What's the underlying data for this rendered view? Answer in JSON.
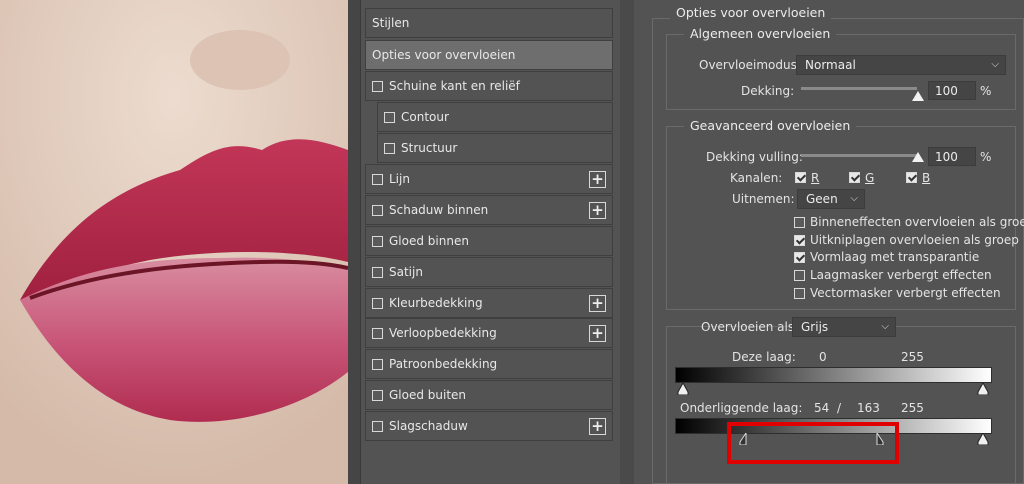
{
  "styles_panel": {
    "items": [
      {
        "label": "Stijlen",
        "checkbox": false,
        "plus": false,
        "selected": false,
        "sub": false
      },
      {
        "label": "Opties voor overvloeien",
        "checkbox": false,
        "plus": false,
        "selected": true,
        "sub": false
      },
      {
        "label": "Schuine kant en reliëf",
        "checkbox": true,
        "plus": false,
        "selected": false,
        "sub": false
      },
      {
        "label": "Contour",
        "checkbox": true,
        "plus": false,
        "selected": false,
        "sub": true
      },
      {
        "label": "Structuur",
        "checkbox": true,
        "plus": false,
        "selected": false,
        "sub": true
      },
      {
        "label": "Lijn",
        "checkbox": true,
        "plus": true,
        "selected": false,
        "sub": false
      },
      {
        "label": "Schaduw binnen",
        "checkbox": true,
        "plus": true,
        "selected": false,
        "sub": false
      },
      {
        "label": "Gloed binnen",
        "checkbox": true,
        "plus": false,
        "selected": false,
        "sub": false
      },
      {
        "label": "Satijn",
        "checkbox": true,
        "plus": false,
        "selected": false,
        "sub": false
      },
      {
        "label": "Kleurbedekking",
        "checkbox": true,
        "plus": true,
        "selected": false,
        "sub": false
      },
      {
        "label": "Verloopbedekking",
        "checkbox": true,
        "plus": true,
        "selected": false,
        "sub": false
      },
      {
        "label": "Patroonbedekking",
        "checkbox": true,
        "plus": false,
        "selected": false,
        "sub": false
      },
      {
        "label": "Gloed buiten",
        "checkbox": true,
        "plus": false,
        "selected": false,
        "sub": false
      },
      {
        "label": "Slagschaduw",
        "checkbox": true,
        "plus": true,
        "selected": false,
        "sub": false
      }
    ],
    "plus_symbol": "+"
  },
  "options": {
    "title": "Opties voor overvloeien",
    "general": {
      "title": "Algemeen overvloeien",
      "blend_mode_label": "Overvloeimodus:",
      "blend_mode_value": "Normaal",
      "opacity_label": "Dekking:",
      "opacity_value": "100",
      "opacity_unit": "%",
      "opacity_level": 1.0
    },
    "advanced": {
      "title": "Geavanceerd overvloeien",
      "fill_opacity_label": "Dekking vulling:",
      "fill_opacity_value": "100",
      "fill_opacity_unit": "%",
      "fill_opacity_level": 1.0,
      "channels_label": "Kanalen:",
      "channel_r": "R",
      "channel_g": "G",
      "channel_b": "B",
      "knockout_label": "Uitnemen:",
      "knockout_value": "Geen",
      "checkboxes": [
        {
          "label": "Binneneffecten overvloeien als groep",
          "checked": false
        },
        {
          "label": "Uitkniplagen overvloeien als groep",
          "checked": true
        },
        {
          "label": "Vormlaag met transparantie",
          "checked": true
        },
        {
          "label": "Laagmasker verbergt effecten",
          "checked": false
        },
        {
          "label": "Vectormasker verbergt effecten",
          "checked": false
        }
      ]
    },
    "blend_if": {
      "label": "Overvloeien als:",
      "value": "Grijs",
      "this_layer_label": "Deze laag:",
      "this_layer_min": "0",
      "this_layer_max": "255",
      "underlying_label": "Onderliggende laag:",
      "underlying_low": "54",
      "underlying_slash": "/",
      "underlying_mid": "163",
      "underlying_max": "255"
    }
  },
  "colors": {
    "highlight": "#e00000",
    "panel_bg": "#535353",
    "selected_item": "#6e6e6e"
  }
}
